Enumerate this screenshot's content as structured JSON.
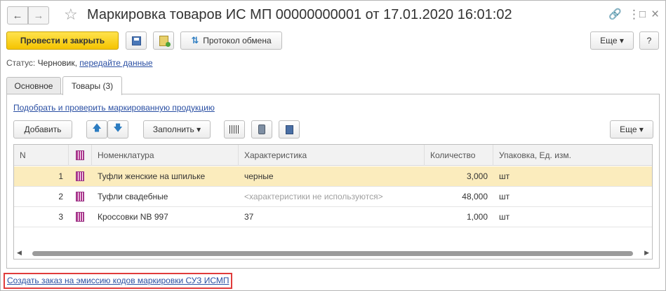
{
  "window": {
    "title": "Маркировка товаров ИС МП 00000000001 от 17.01.2020 16:01:02",
    "nav_back": "←",
    "nav_forward": "→",
    "star": "☆",
    "link_icon": "🔗",
    "menu_icon": "⋮",
    "maximize_icon": "□",
    "close_icon": "×"
  },
  "toolbar": {
    "post_close_label": "Провести и закрыть",
    "exchange_log_label": "Протокол обмена",
    "more_label": "Еще ▾",
    "help_label": "?"
  },
  "status": {
    "label": "Статус:",
    "value": "Черновик,",
    "action_link": "передайте данные"
  },
  "tabs": [
    {
      "label": "Основное",
      "active": false
    },
    {
      "label": "Товары (3)",
      "active": true
    }
  ],
  "goods": {
    "select_link": "Подобрать и проверить маркированную продукцию",
    "add_label": "Добавить",
    "up_icon": "🡅",
    "down_icon": "🡇",
    "fill_label": "Заполнить ▾",
    "more_label": "Еще ▾",
    "columns": [
      "N",
      "",
      "Номенклатура",
      "Характеристика",
      "Количество",
      "Упаковка, Ед. изм."
    ],
    "rows": [
      {
        "n": "1",
        "item": "Туфли женские на шпильке",
        "characteristic": "черные",
        "qty": "3,000",
        "unit": "шт",
        "selected": true,
        "characteristic_placeholder": false
      },
      {
        "n": "2",
        "item": "Туфли свадебные",
        "characteristic": "<характеристики не используются>",
        "qty": "48,000",
        "unit": "шт",
        "selected": false,
        "characteristic_placeholder": true
      },
      {
        "n": "3",
        "item": "Кроссовки NB 997",
        "characteristic": "37",
        "qty": "1,000",
        "unit": "шт",
        "selected": false,
        "characteristic_placeholder": false
      }
    ],
    "scroll_left": "◀",
    "scroll_right": "▶"
  },
  "bottom_link": "Создать заказ на эмиссию кодов маркировки СУЗ ИСМП",
  "colors": {
    "primary_button": "#f5c400",
    "link": "#2a4fa3",
    "selected_row": "#fbecbd",
    "highlight_border": "#e03c3c"
  }
}
